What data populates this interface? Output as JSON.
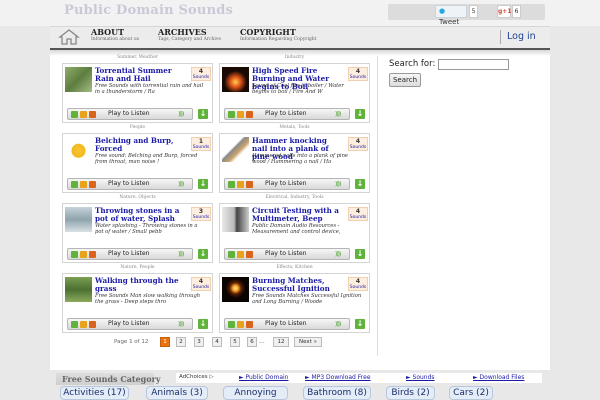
{
  "header": {
    "site_title": "Public Domain Sounds",
    "tweet_label": "Tweet",
    "tweet_count": "5",
    "gplus_label": "g+1",
    "gplus_count": "6"
  },
  "nav": {
    "items": [
      {
        "title": "ABOUT",
        "sub": "Information about us"
      },
      {
        "title": "ARCHIVES",
        "sub": "Tags, Category and Archive"
      },
      {
        "title": "COPYRIGHT",
        "sub": "Information Regarding Copyright"
      }
    ],
    "login": "Log in"
  },
  "cards": [
    {
      "category": "Summer, Weather",
      "title": "Torrential Summer Rain and Hail",
      "desc": "Free Sounds with torrential rain and hail in a thunderstorm / Ra",
      "count": "4",
      "count_label": "Sounds",
      "play": "Play to Listen",
      "thumb": "rain-thumbnail"
    },
    {
      "category": "Industry",
      "title": "High Speed Fire Burning and Water begins to Boil",
      "desc": "Sound of Cool fire in boiler / Water begins to boil / Fire And W",
      "count": "4",
      "count_label": "Sounds",
      "play": "Play to Listen",
      "thumb": "fire-thumbnail"
    },
    {
      "category": "People",
      "title": "Belching and Burp, Forced",
      "desc": "Free sound: Belching and Burp, forced from throat, man noise !",
      "count": "1",
      "count_label": "Sounds",
      "play": "Play to Listen",
      "thumb": "beer-thumbnail"
    },
    {
      "category": "Metals, Tools",
      "title": "Hammer knocking nail into a plank of pine wood",
      "desc": "Hammered nails into a plank of pine wood / Hammering a nail / Ha",
      "count": "4",
      "count_label": "Sounds",
      "play": "Play to Listen",
      "thumb": "hammer-thumbnail"
    },
    {
      "category": "Nature, Objects",
      "title": "Throwing stones in a pot of water, Splash",
      "desc": "Water splashing - Throwing stones in a pot of water / Small pebb",
      "count": "3",
      "count_label": "Sounds",
      "play": "Play to Listen",
      "thumb": "splash-thumbnail"
    },
    {
      "category": "Electrical, Industry, Tools",
      "title": "Circuit Testing with a Multimeter, Beep",
      "desc": "Public Domain Audio Resources - Measurement and control device,",
      "count": "4",
      "count_label": "Sounds",
      "play": "Play to Listen",
      "thumb": "multimeter-thumbnail"
    },
    {
      "category": "Nature, People",
      "title": "Walking through the grass",
      "desc": "Free Sounds Man slow walking through the grass - Deep steps thro",
      "count": "4",
      "count_label": "Sounds",
      "play": "Play to Listen",
      "thumb": "grass-thumbnail"
    },
    {
      "category": "Effects, Kitchen",
      "title": "Burning Matches, Successful Ignition",
      "desc": "Free Sounds Matches Successful Ignition and Long Burning / Woode",
      "count": "4",
      "count_label": "Sounds",
      "play": "Play to Listen",
      "thumb": "match-thumbnail"
    }
  ],
  "pagination": {
    "label": "Page 1 of 12",
    "pages": [
      "1",
      "2",
      "3",
      "4",
      "5",
      "6",
      "12"
    ],
    "current": "1",
    "dots": "...",
    "next": "Next »"
  },
  "search": {
    "label": "Search for:",
    "placeholder": "",
    "button": "Search"
  },
  "categories": {
    "heading": "Free Sounds Category",
    "adchoices": "AdChoices ▷",
    "ad_links": [
      "► Public Domain",
      "► MP3 Download Free",
      "► Sounds",
      "► Download Files"
    ],
    "tags": [
      "Activities (17)",
      "Animals (3)",
      "Annoying (15)",
      "Bathroom (8)",
      "Birds (2)",
      "Cars (2)"
    ]
  },
  "colors": {
    "title_blue": "#1a1aa6",
    "active_page": "#e8730c",
    "download_green": "#5fb23a"
  }
}
